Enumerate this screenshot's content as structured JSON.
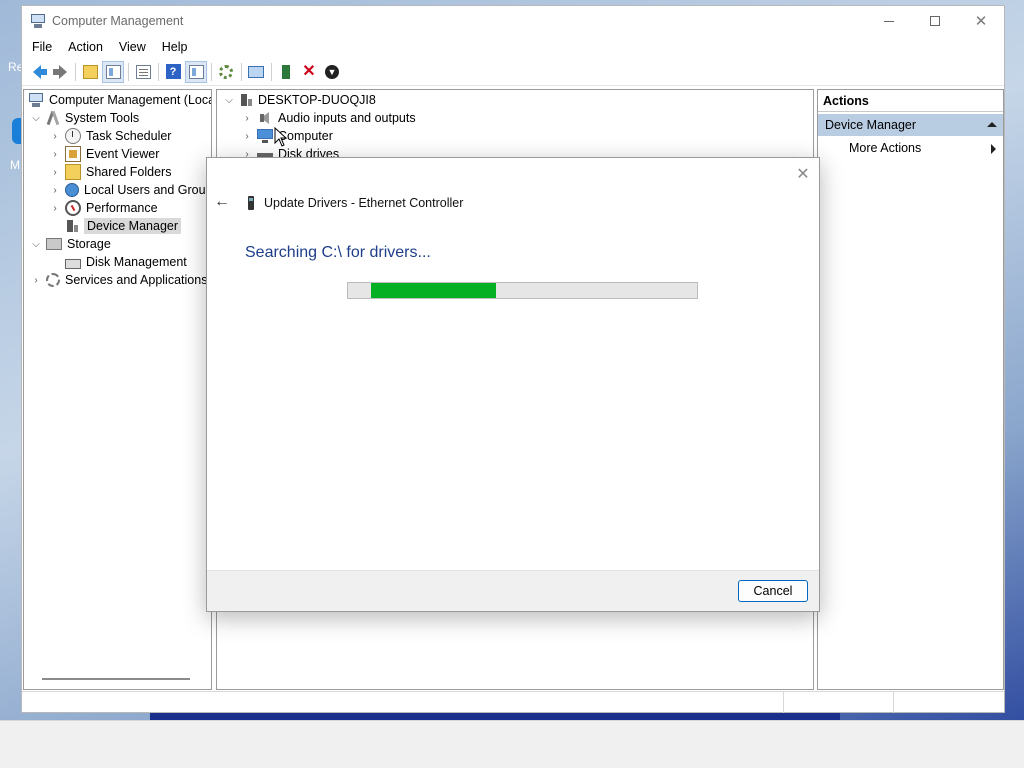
{
  "desktop": {
    "icon_label_1": "Re",
    "icon_label_2": "M"
  },
  "window": {
    "title": "Computer Management",
    "minimize_label": "—",
    "close_glyph": "✕"
  },
  "menu": [
    "File",
    "Action",
    "View",
    "Help"
  ],
  "toolbar": {
    "icons": [
      "back-icon",
      "forward-icon",
      "up-folder-icon",
      "show-hide-tree-icon",
      "properties-icon",
      "help-icon",
      "show-hide-action-icon",
      "scan-hardware-icon",
      "monitor-icon",
      "update-driver-icon",
      "uninstall-icon",
      "disable-icon"
    ]
  },
  "left_tree": {
    "root": "Computer Management (Local",
    "system_tools": "System Tools",
    "task_scheduler": "Task Scheduler",
    "event_viewer": "Event Viewer",
    "shared_folders": "Shared Folders",
    "local_users": "Local Users and Groups",
    "performance": "Performance",
    "device_manager": "Device Manager",
    "storage": "Storage",
    "disk_management": "Disk Management",
    "services": "Services and Applications"
  },
  "center_tree": {
    "computer_name": "DESKTOP-DUOQJI8",
    "audio": "Audio inputs and outputs",
    "computer": "Computer",
    "disk_drives": "Disk drives"
  },
  "actions": {
    "header": "Actions",
    "section": "Device Manager",
    "more_actions": "More Actions"
  },
  "dialog": {
    "title": "Update Drivers - Ethernet Controller",
    "status": "Searching C:\\ for drivers...",
    "progress": 0.36,
    "progress_offset": 0.065,
    "cancel_label": "Cancel",
    "close_glyph": "✕",
    "back_glyph": "←",
    "accent_color": "#06b025"
  }
}
